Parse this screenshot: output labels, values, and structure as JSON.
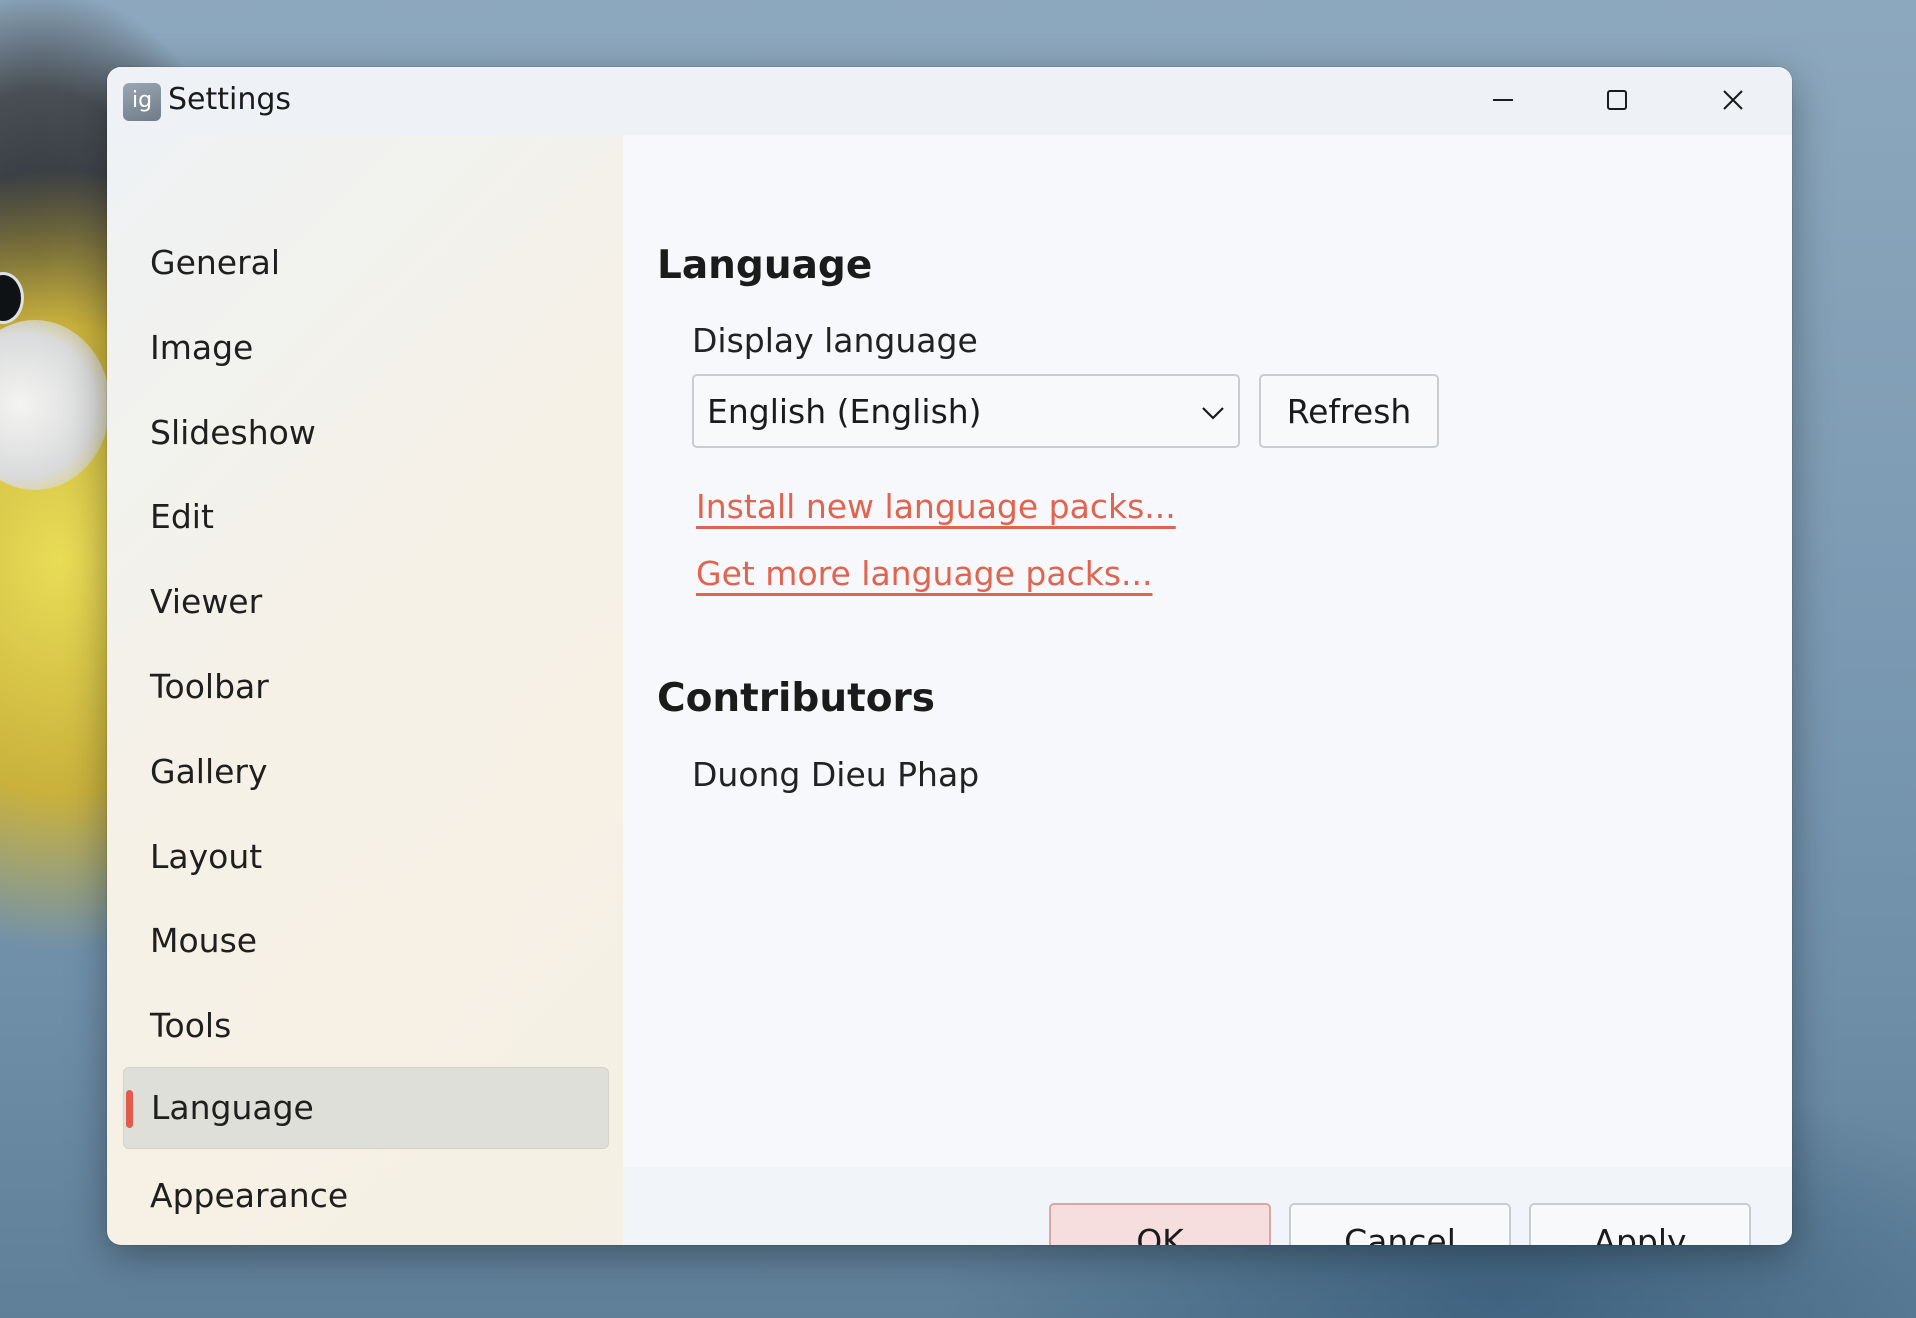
{
  "window": {
    "title": "Settings",
    "app_icon_text": "ig",
    "controls": [
      "minimize",
      "maximize",
      "close"
    ]
  },
  "sidebar": {
    "items": [
      {
        "label": "General",
        "active": false
      },
      {
        "label": "Image",
        "active": false
      },
      {
        "label": "Slideshow",
        "active": false
      },
      {
        "label": "Edit",
        "active": false
      },
      {
        "label": "Viewer",
        "active": false
      },
      {
        "label": "Toolbar",
        "active": false
      },
      {
        "label": "Gallery",
        "active": false
      },
      {
        "label": "Layout",
        "active": false
      },
      {
        "label": "Mouse",
        "active": false
      },
      {
        "label": "Tools",
        "active": false
      },
      {
        "label": "Language",
        "active": true
      },
      {
        "label": "Appearance",
        "active": false
      }
    ]
  },
  "language": {
    "heading": "Language",
    "display_language_label": "Display language",
    "selected_language": "English (English)",
    "refresh_label": "Refresh",
    "install_link": "Install new language packs...",
    "get_more_link": "Get more language packs..."
  },
  "contributors": {
    "heading": "Contributors",
    "names": [
      "Duong Dieu Phap"
    ]
  },
  "footer": {
    "ok_label": "OK",
    "cancel_label": "Cancel",
    "apply_label": "Apply"
  },
  "colors": {
    "accent": "#e25b4b",
    "link": "#e0644f",
    "ok_background": "#f6dede"
  }
}
